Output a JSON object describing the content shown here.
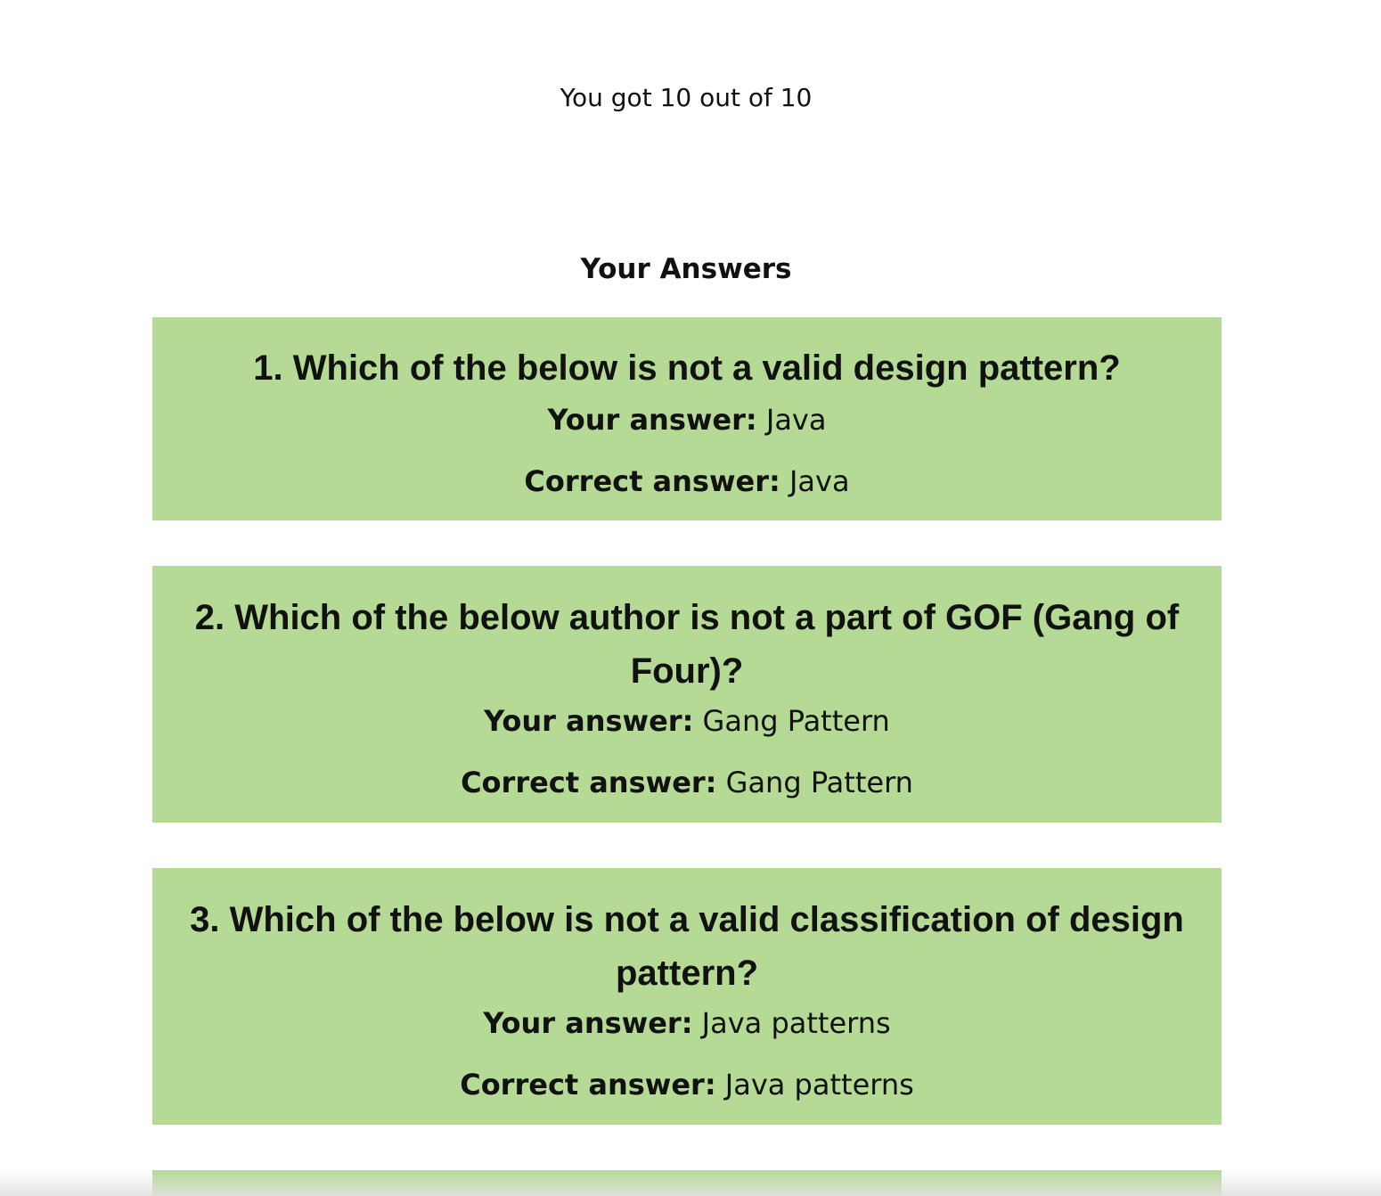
{
  "result": {
    "score_text": "You got 10 out of 10"
  },
  "answers_section": {
    "heading": "Your Answers",
    "your_answer_label": "Your answer:",
    "correct_answer_label": "Correct answer:",
    "items": [
      {
        "question": "1. Which of the below is not a valid design pattern?",
        "your_answer": "Java",
        "correct_answer": "Java"
      },
      {
        "question": "2. Which of the below author is not a part of GOF (Gang of Four)?",
        "your_answer": "Gang Pattern",
        "correct_answer": "Gang Pattern"
      },
      {
        "question": "3. Which of the below is not a valid classification of design pattern?",
        "your_answer": "Java patterns",
        "correct_answer": "Java patterns"
      }
    ]
  },
  "colors": {
    "card_background": "#b5da95",
    "text": "#111111",
    "page_background": "#ffffff"
  }
}
